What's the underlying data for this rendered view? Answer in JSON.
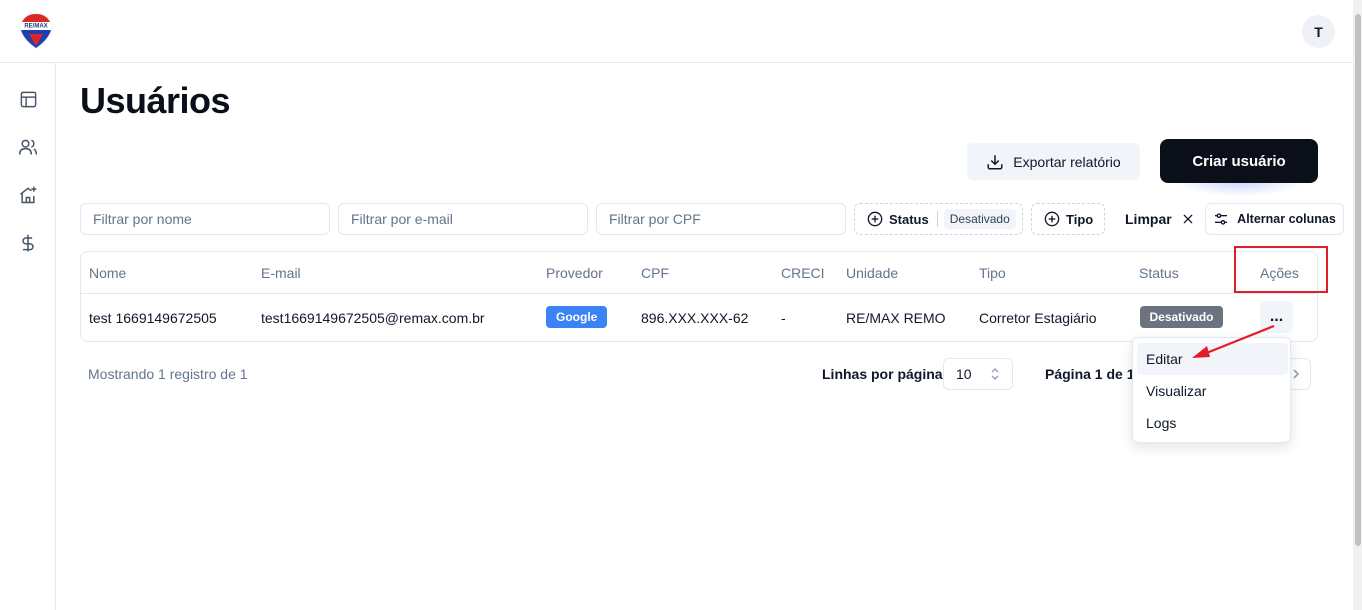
{
  "header": {
    "logo_text": "RE/MAX",
    "avatar_initial": "T"
  },
  "sidebar": {
    "items": [
      {
        "icon": "layout-icon"
      },
      {
        "icon": "users-icon"
      },
      {
        "icon": "home-plus-icon"
      },
      {
        "icon": "dollar-icon"
      }
    ]
  },
  "page": {
    "title": "Usuários"
  },
  "actions": {
    "export_label": "Exportar relatório",
    "create_label": "Criar usuário"
  },
  "filters": {
    "name_placeholder": "Filtrar por nome",
    "email_placeholder": "Filtrar por e-mail",
    "cpf_placeholder": "Filtrar por CPF",
    "status_label": "Status",
    "status_value": "Desativado",
    "type_label": "Tipo",
    "clear_label": "Limpar",
    "columns_label": "Alternar colunas"
  },
  "table": {
    "columns": [
      "Nome",
      "E-mail",
      "Provedor",
      "CPF",
      "CRECI",
      "Unidade",
      "Tipo",
      "Status",
      "Ações"
    ],
    "rows": [
      {
        "nome": "test 1669149672505",
        "email": "test1669149672505@remax.com.br",
        "provedor": "Google",
        "cpf": "896.XXX.XXX-62",
        "creci": "-",
        "unidade": "RE/MAX REMO",
        "tipo": "Corretor Estagiário",
        "status": "Desativado",
        "acoes": "..."
      }
    ]
  },
  "footer": {
    "count_text": "Mostrando 1 registro de 1",
    "rows_per_page_label": "Linhas por página",
    "rows_per_page_value": "10",
    "page_text": "Página 1 de 1"
  },
  "menu": {
    "items": [
      "Editar",
      "Visualizar",
      "Logs"
    ]
  },
  "colors": {
    "primary_dark": "#0b0f19",
    "google_badge": "#3b82f6",
    "status_badge": "#6b7280",
    "highlight": "#e11d2a"
  }
}
